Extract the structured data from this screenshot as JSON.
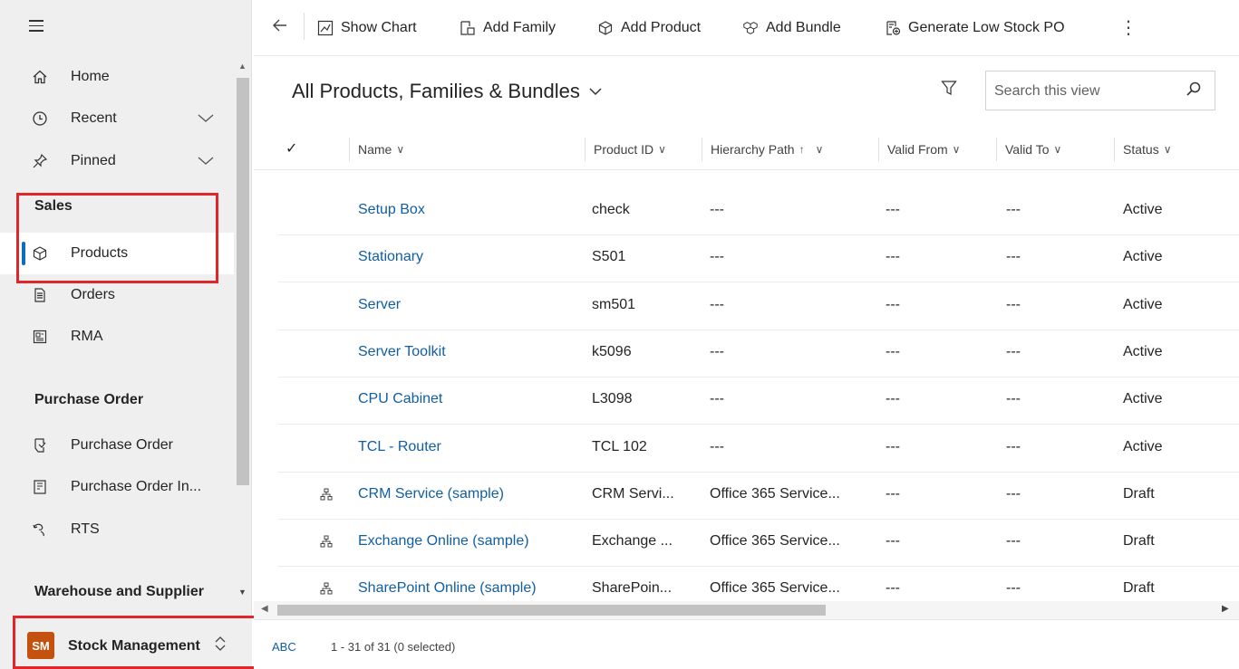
{
  "sidebar": {
    "items_top": [
      {
        "label": "Home",
        "icon": "home-icon"
      },
      {
        "label": "Recent",
        "icon": "clock-icon"
      },
      {
        "label": "Pinned",
        "icon": "pin-icon"
      }
    ],
    "groups": {
      "sales": {
        "heading": "Sales",
        "items": [
          {
            "label": "Products",
            "icon": "cube-icon",
            "active": true
          },
          {
            "label": "Orders",
            "icon": "document-icon"
          },
          {
            "label": "RMA",
            "icon": "form-icon"
          }
        ]
      },
      "purchase_order": {
        "heading": "Purchase Order",
        "items": [
          {
            "label": "Purchase Order",
            "icon": "cart-icon"
          },
          {
            "label": "Purchase Order In...",
            "icon": "invoice-icon"
          },
          {
            "label": "RTS",
            "icon": "return-icon"
          }
        ]
      },
      "warehouse": {
        "heading": "Warehouse and Supplier"
      }
    },
    "area": {
      "badge": "SM",
      "label": "Stock Management",
      "badge_color": "#c4520e"
    }
  },
  "commands": {
    "show_chart": "Show Chart",
    "add_family": "Add Family",
    "add_product": "Add Product",
    "add_bundle": "Add Bundle",
    "generate_po": "Generate Low Stock PO"
  },
  "view": {
    "title": "All Products, Families & Bundles",
    "search_placeholder": "Search this view"
  },
  "grid": {
    "columns": {
      "name": "Name",
      "product_id": "Product ID",
      "hierarchy": "Hierarchy Path",
      "valid_from": "Valid From",
      "valid_to": "Valid To",
      "status": "Status"
    },
    "rows": [
      {
        "name": "Setup Box",
        "product_id": "check",
        "hierarchy": "---",
        "valid_from": "---",
        "valid_to": "---",
        "status": "Active",
        "has_hierarchy_icon": false
      },
      {
        "name": "Stationary",
        "product_id": "S501",
        "hierarchy": "---",
        "valid_from": "---",
        "valid_to": "---",
        "status": "Active",
        "has_hierarchy_icon": false
      },
      {
        "name": "Server",
        "product_id": "sm501",
        "hierarchy": "---",
        "valid_from": "---",
        "valid_to": "---",
        "status": "Active",
        "has_hierarchy_icon": false
      },
      {
        "name": "Server Toolkit",
        "product_id": "k5096",
        "hierarchy": "---",
        "valid_from": "---",
        "valid_to": "---",
        "status": "Active",
        "has_hierarchy_icon": false
      },
      {
        "name": "CPU Cabinet",
        "product_id": "L3098",
        "hierarchy": "---",
        "valid_from": "---",
        "valid_to": "---",
        "status": "Active",
        "has_hierarchy_icon": false
      },
      {
        "name": "TCL - Router",
        "product_id": "TCL 102",
        "hierarchy": "---",
        "valid_from": "---",
        "valid_to": "---",
        "status": "Active",
        "has_hierarchy_icon": false
      },
      {
        "name": "CRM Service (sample)",
        "product_id": "CRM Servi...",
        "hierarchy": "Office 365 Service...",
        "valid_from": "---",
        "valid_to": "---",
        "status": "Draft",
        "has_hierarchy_icon": true
      },
      {
        "name": "Exchange Online (sample)",
        "product_id": "Exchange ...",
        "hierarchy": "Office 365 Service...",
        "valid_from": "---",
        "valid_to": "---",
        "status": "Draft",
        "has_hierarchy_icon": true
      },
      {
        "name": "SharePoint Online (sample)",
        "product_id": "SharePoin...",
        "hierarchy": "Office 365 Service...",
        "valid_from": "---",
        "valid_to": "---",
        "status": "Draft",
        "has_hierarchy_icon": true
      }
    ],
    "footer": {
      "jump_bar": "ABC",
      "count": "1 - 31 of 31 (0 selected)"
    }
  },
  "colors": {
    "link": "#115ea3",
    "accent": "#0f6cbd",
    "highlight_box": "#e0262a",
    "sidebar_bg": "#efefef"
  }
}
